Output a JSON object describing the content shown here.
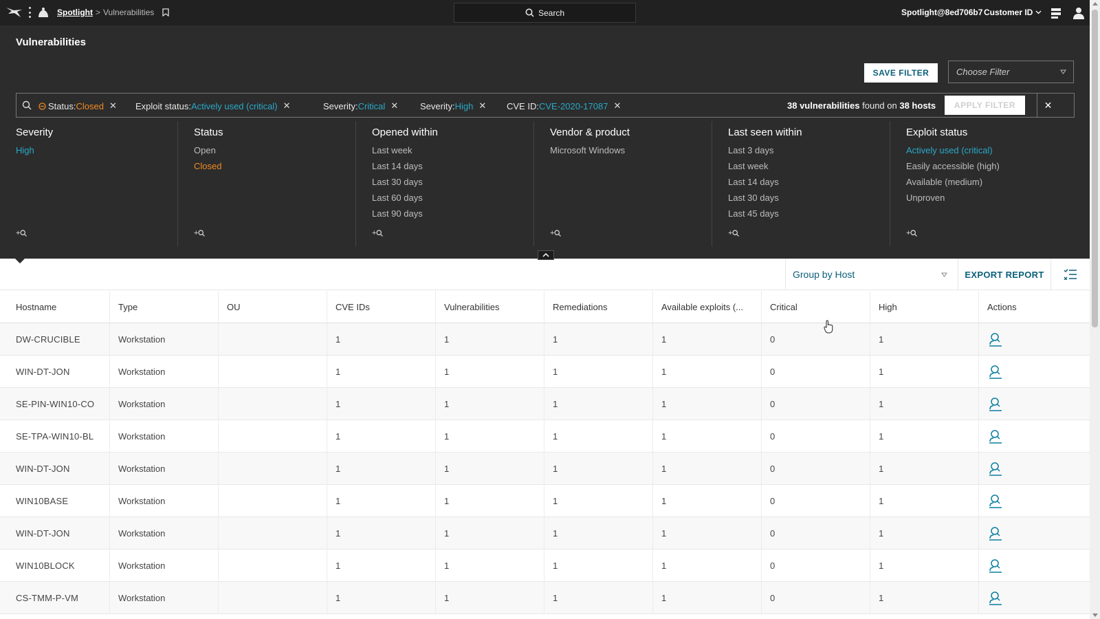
{
  "topbar": {
    "breadcrumb_root": "Spotlight",
    "breadcrumb_sep": ">",
    "breadcrumb_current": "Vulnerabilities",
    "search_label": "Search",
    "user": "Spotlight@8ed706b7",
    "customer_label": "Customer ID"
  },
  "header": {
    "title": "Vulnerabilities",
    "save_filter": "SAVE FILTER",
    "choose_filter_placeholder": "Choose Filter"
  },
  "filterbar": {
    "chips": [
      {
        "label": "Status:",
        "value": "Closed"
      },
      {
        "label": "Exploit status:",
        "value": "Actively used (critical)"
      },
      {
        "label": "Severity:",
        "value": "Critical"
      },
      {
        "label": "Severity:",
        "value": "High"
      },
      {
        "label": "CVE ID:",
        "value": "CVE-2020-17087"
      }
    ],
    "found_count": "38 vulnerabilities",
    "found_mid": "found on",
    "found_hosts": "38 hosts",
    "apply_filter": "APPLY FILTER",
    "clear_symbol": "✕",
    "chip_close": "✕"
  },
  "facets": [
    {
      "title": "Severity",
      "options": [
        "High"
      ]
    },
    {
      "title": "Status",
      "options": [
        "Open",
        "Closed"
      ]
    },
    {
      "title": "Opened within",
      "options": [
        "Last week",
        "Last 14 days",
        "Last 30 days",
        "Last 60 days",
        "Last 90 days"
      ]
    },
    {
      "title": "Vendor & product",
      "options": [
        "Microsoft Windows"
      ]
    },
    {
      "title": "Last seen within",
      "options": [
        "Last 3 days",
        "Last week",
        "Last 14 days",
        "Last 30 days",
        "Last 45 days"
      ]
    },
    {
      "title": "Exploit status",
      "options": [
        "Actively used (critical)",
        "Easily accessible (high)",
        "Available (medium)",
        "Unproven"
      ]
    }
  ],
  "facet_more": "+",
  "toolbar": {
    "group_by": "Group by Host",
    "export_report": "EXPORT REPORT"
  },
  "table": {
    "columns": [
      "Hostname",
      "Type",
      "OU",
      "CVE IDs",
      "Vulnerabilities",
      "Remediations",
      "Available exploits (...",
      "Critical",
      "High",
      "Actions"
    ],
    "rows": [
      {
        "hostname": "DW-CRUCIBLE",
        "type": "Workstation",
        "ou": "",
        "cve_ids": "1",
        "vulnerabilities": "1",
        "remediations": "1",
        "exploits": "1",
        "critical": "0",
        "high": "1"
      },
      {
        "hostname": "WIN-DT-JON",
        "type": "Workstation",
        "ou": "",
        "cve_ids": "1",
        "vulnerabilities": "1",
        "remediations": "1",
        "exploits": "1",
        "critical": "0",
        "high": "1"
      },
      {
        "hostname": "SE-PIN-WIN10-CO",
        "type": "Workstation",
        "ou": "",
        "cve_ids": "1",
        "vulnerabilities": "1",
        "remediations": "1",
        "exploits": "1",
        "critical": "0",
        "high": "1"
      },
      {
        "hostname": "SE-TPA-WIN10-BL",
        "type": "Workstation",
        "ou": "",
        "cve_ids": "1",
        "vulnerabilities": "1",
        "remediations": "1",
        "exploits": "1",
        "critical": "0",
        "high": "1"
      },
      {
        "hostname": "WIN-DT-JON",
        "type": "Workstation",
        "ou": "",
        "cve_ids": "1",
        "vulnerabilities": "1",
        "remediations": "1",
        "exploits": "1",
        "critical": "0",
        "high": "1"
      },
      {
        "hostname": "WIN10BASE",
        "type": "Workstation",
        "ou": "",
        "cve_ids": "1",
        "vulnerabilities": "1",
        "remediations": "1",
        "exploits": "1",
        "critical": "0",
        "high": "1"
      },
      {
        "hostname": "WIN-DT-JON",
        "type": "Workstation",
        "ou": "",
        "cve_ids": "1",
        "vulnerabilities": "1",
        "remediations": "1",
        "exploits": "1",
        "critical": "0",
        "high": "1"
      },
      {
        "hostname": "WIN10BLOCK",
        "type": "Workstation",
        "ou": "",
        "cve_ids": "1",
        "vulnerabilities": "1",
        "remediations": "1",
        "exploits": "1",
        "critical": "0",
        "high": "1"
      },
      {
        "hostname": "CS-TMM-P-VM",
        "type": "Workstation",
        "ou": "",
        "cve_ids": "1",
        "vulnerabilities": "1",
        "remediations": "1",
        "exploits": "1",
        "critical": "0",
        "high": "1"
      }
    ]
  },
  "colors": {
    "accent_blue": "#29a8c8",
    "accent_orange": "#f08a24",
    "brand_teal": "#0a5f7a",
    "topbar_bg": "#212121",
    "panel_bg": "#2c2c2c"
  },
  "icons": {
    "logo": "falcon-logo-icon",
    "app": "spotlight-app-icon",
    "bookmark": "bookmark-icon",
    "search": "search-icon",
    "status": "minus-circle-icon",
    "action": "host-investigate-icon",
    "columns": "column-settings-icon"
  }
}
